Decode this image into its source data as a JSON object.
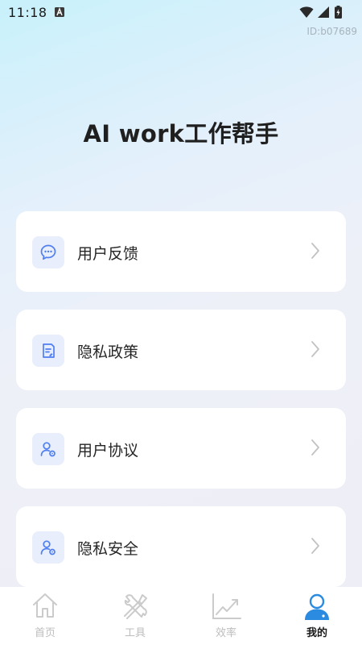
{
  "status_bar": {
    "time": "11:18",
    "indicator_icon": "a-box-icon",
    "wifi_icon": "wifi-icon",
    "signal_icon": "signal-icon",
    "battery_icon": "battery-charging-icon"
  },
  "id_label": "ID:b07689",
  "title": "AI work工作帮手",
  "menu": [
    {
      "label": "用户反馈",
      "icon": "chat-bubble-icon"
    },
    {
      "label": "隐私政策",
      "icon": "document-icon"
    },
    {
      "label": "用户协议",
      "icon": "user-settings-icon"
    },
    {
      "label": "隐私安全",
      "icon": "user-settings-icon"
    }
  ],
  "bottom_nav": [
    {
      "label": "首页",
      "icon": "home-icon",
      "active": false
    },
    {
      "label": "工具",
      "icon": "tools-icon",
      "active": false
    },
    {
      "label": "效率",
      "icon": "chart-trend-icon",
      "active": false
    },
    {
      "label": "我的",
      "icon": "profile-icon",
      "active": true
    }
  ],
  "colors": {
    "accent": "#4f7ff0",
    "nav_active": "#2a8be0",
    "nav_inactive": "#c4c4c4",
    "icon_bg": "#e8eefb"
  }
}
